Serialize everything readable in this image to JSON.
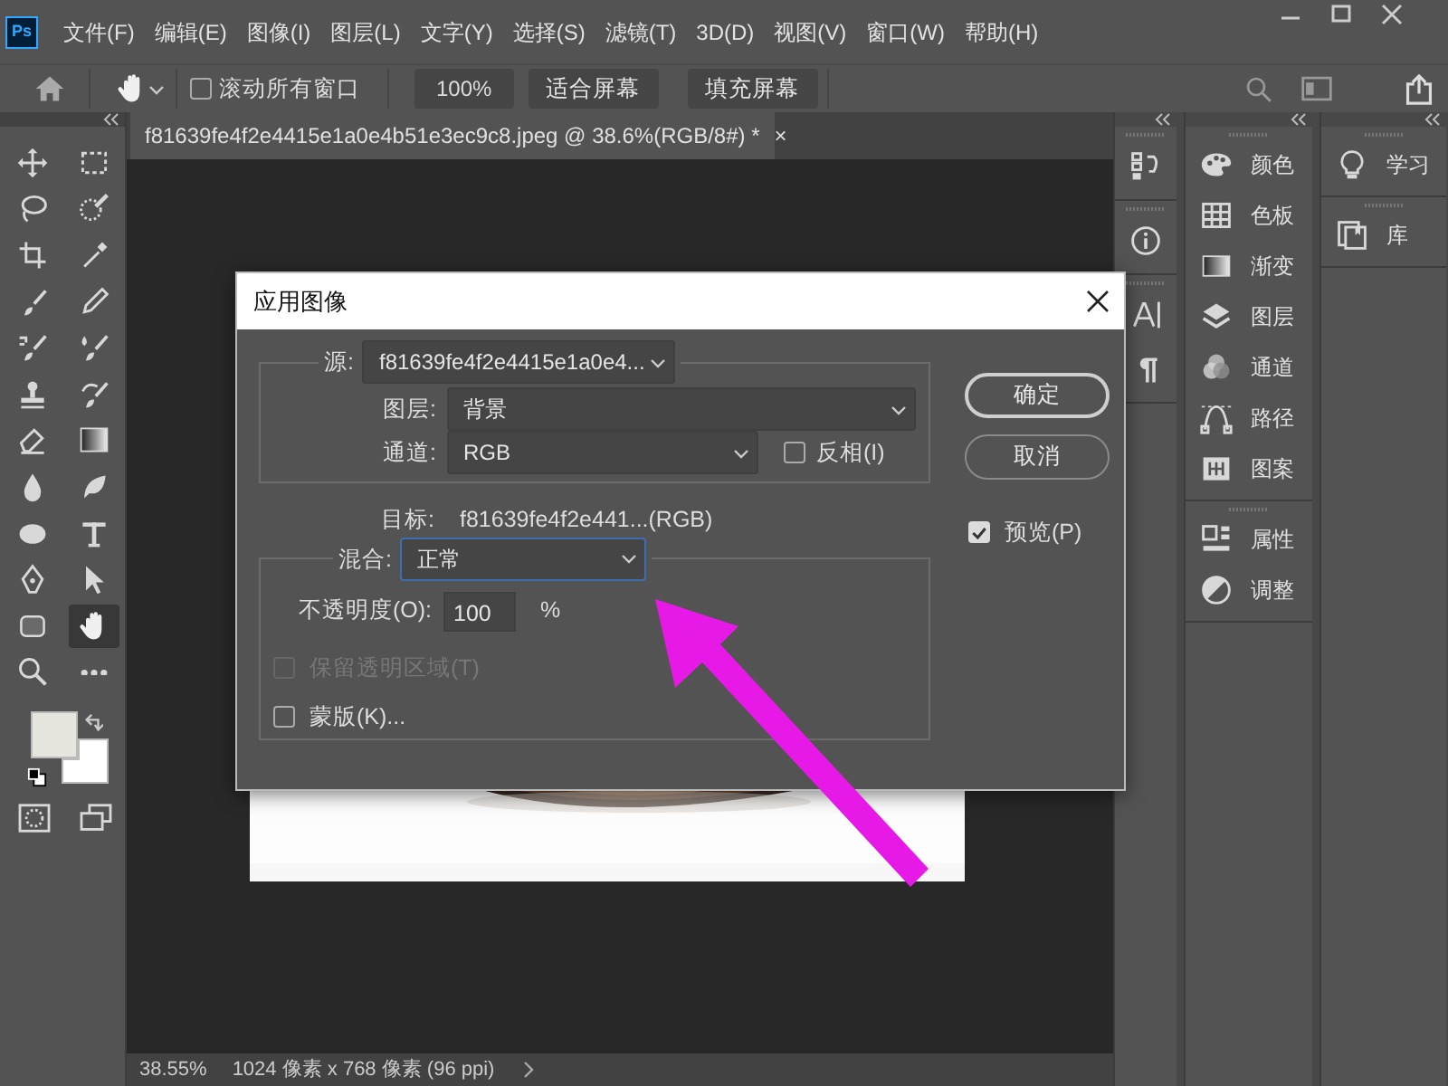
{
  "menu_bar": {
    "app_icon": "Ps",
    "items": [
      "文件(F)",
      "编辑(E)",
      "图像(I)",
      "图层(L)",
      "文字(Y)",
      "选择(S)",
      "滤镜(T)",
      "3D(D)",
      "视图(V)",
      "窗口(W)",
      "帮助(H)"
    ]
  },
  "options_bar": {
    "scroll_all_windows": {
      "label": "滚动所有窗口",
      "checked": false
    },
    "zoom": "100%",
    "buttons": [
      "适合屏幕",
      "填充屏幕"
    ]
  },
  "document_tab": {
    "title": "f81639fe4f2e4415e1a0e4b51e3ec9c8.jpeg @ 38.6%(RGB/8#) *",
    "close": "×"
  },
  "tools": [
    {
      "selected": false
    },
    {
      "selected": false
    },
    {
      "selected": false
    },
    {
      "selected": false
    },
    {
      "selected": false
    },
    {
      "selected": false
    },
    {
      "selected": false
    },
    {
      "selected": false
    },
    {
      "selected": false
    },
    {
      "selected": false
    },
    {
      "selected": false
    },
    {
      "selected": false
    },
    {
      "selected": false
    },
    {
      "selected": false
    },
    {
      "selected": false
    },
    {
      "selected": false
    },
    {
      "selected": false
    },
    {
      "selected": false
    },
    {
      "selected": false
    },
    {
      "selected": false
    },
    {
      "selected": false
    },
    {
      "selected": true
    },
    {
      "selected": false
    },
    {
      "selected": false
    }
  ],
  "swatches": [
    {
      "kind": "foreground",
      "color": "#e6e6de"
    },
    {
      "kind": "background",
      "color": "#ffffff"
    }
  ],
  "panel_columns": [
    {
      "groups": [
        {
          "items": [
            {
              "kind": "icon"
            }
          ]
        },
        {
          "items": [
            {
              "kind": "icon"
            }
          ]
        },
        {
          "items": [
            {
              "kind": "icon"
            },
            {
              "kind": "icon"
            }
          ]
        }
      ]
    },
    {
      "groups": [
        {
          "items": [
            {
              "kind": "labeled",
              "label": "颜色"
            },
            {
              "kind": "labeled",
              "label": "色板"
            },
            {
              "kind": "labeled",
              "label": "渐变"
            },
            {
              "kind": "labeled",
              "label": "图层"
            },
            {
              "kind": "labeled",
              "label": "通道"
            },
            {
              "kind": "labeled",
              "label": "路径"
            },
            {
              "kind": "labeled",
              "label": "图案"
            }
          ]
        },
        {
          "items": [
            {
              "kind": "labeled",
              "label": "属性"
            },
            {
              "kind": "labeled",
              "label": "调整"
            }
          ]
        }
      ]
    },
    {
      "groups": [
        {
          "items": [
            {
              "kind": "labeled",
              "label": "学习"
            }
          ]
        },
        {
          "items": [
            {
              "kind": "labeled",
              "label": "库"
            }
          ]
        }
      ]
    }
  ],
  "dialog": {
    "title": "应用图像",
    "source": {
      "label": "源:",
      "value": "f81639fe4f2e4415e1a0e4..."
    },
    "layer": {
      "label": "图层:",
      "value": "背景"
    },
    "channel": {
      "label": "通道:",
      "value": "RGB"
    },
    "invert": {
      "label": "反相(I)",
      "checked": false
    },
    "target": {
      "label": "目标:",
      "value": "f81639fe4f2e441...(RGB)"
    },
    "blending": {
      "label": "混合:",
      "value": "正常",
      "focused": true
    },
    "opacity": {
      "label": "不透明度(O):",
      "value": "100",
      "unit": "%"
    },
    "preserve_transparency": {
      "label": "保留透明区域(T)",
      "checked": false,
      "disabled": true
    },
    "mask": {
      "label": "蒙版(K)...",
      "checked": false
    },
    "buttons": [
      {
        "label": "确定",
        "default": true
      },
      {
        "label": "取消",
        "default": false
      }
    ],
    "preview": {
      "label": "预览(P)",
      "checked": true
    }
  },
  "status_bar": {
    "zoom": "38.55%",
    "info": "1024 像素 x 768 像素 (96 ppi)"
  }
}
